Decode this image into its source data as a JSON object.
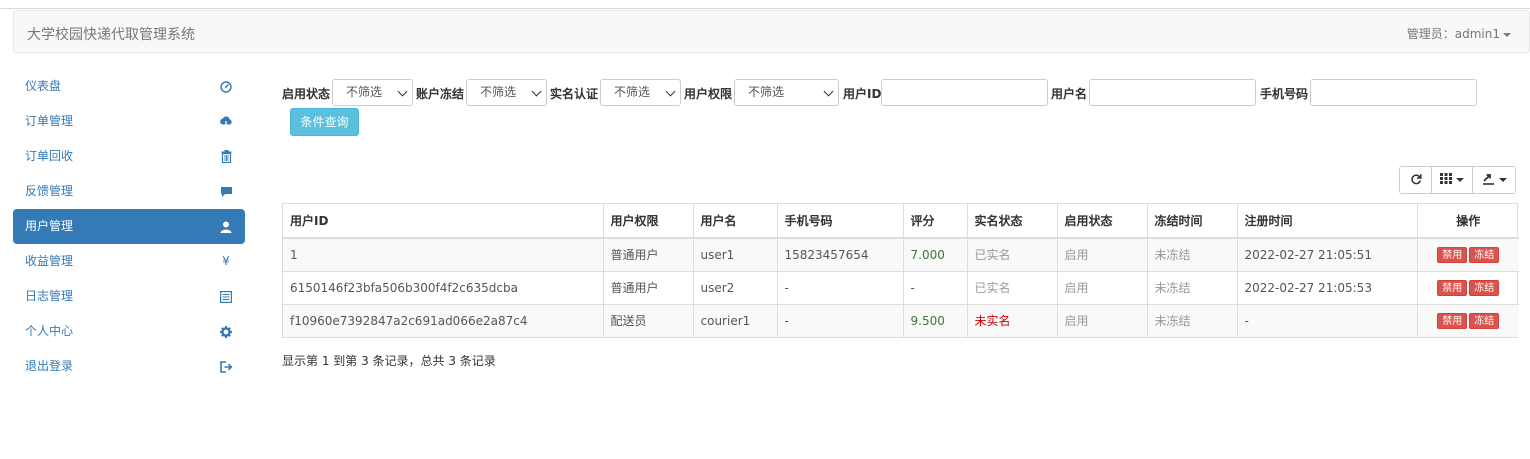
{
  "app": {
    "title": "大学校园快递代取管理系统",
    "admin_label": "管理员：admin1"
  },
  "sidebar": {
    "items": [
      {
        "label": "仪表盘",
        "icon": "dashboard-icon"
      },
      {
        "label": "订单管理",
        "icon": "cloud-download-icon"
      },
      {
        "label": "订单回收",
        "icon": "trash-icon"
      },
      {
        "label": "反馈管理",
        "icon": "comment-icon"
      },
      {
        "label": "用户管理",
        "icon": "user-icon",
        "active": true
      },
      {
        "label": "收益管理",
        "icon": "yen-icon"
      },
      {
        "label": "日志管理",
        "icon": "list-alt-icon"
      },
      {
        "label": "个人中心",
        "icon": "cog-icon"
      },
      {
        "label": "退出登录",
        "icon": "log-out-icon"
      }
    ],
    "active_color": "#337ab7"
  },
  "filters": {
    "enable_status": {
      "label": "启用状态",
      "value": "不筛选"
    },
    "freeze": {
      "label": "账户冻结",
      "value": "不筛选"
    },
    "realname": {
      "label": "实名认证",
      "value": "不筛选"
    },
    "permission": {
      "label": "用户权限",
      "value": "不筛选"
    },
    "user_id": {
      "label": "用户ID",
      "value": ""
    },
    "username": {
      "label": "用户名",
      "value": ""
    },
    "phone": {
      "label": "手机号码",
      "value": ""
    },
    "query_button": "条件查询"
  },
  "table": {
    "columns": [
      "用户ID",
      "用户权限",
      "用户名",
      "手机号码",
      "评分",
      "实名状态",
      "启用状态",
      "冻结时间",
      "注册时间",
      "操作"
    ],
    "rows": [
      {
        "id": "1",
        "role": "普通用户",
        "name": "user1",
        "phone": "15823457654",
        "score": "7.000",
        "realname": "已实名",
        "enabled": "启用",
        "frozen": "未冻结",
        "registered": "2022-02-27 21:05:51",
        "op1": "禁用",
        "op2": "冻结"
      },
      {
        "id": "6150146f23bfa506b300f4f2c635dcba",
        "role": "普通用户",
        "name": "user2",
        "phone": "-",
        "score": "-",
        "realname": "已实名",
        "enabled": "启用",
        "frozen": "未冻结",
        "registered": "2022-02-27 21:05:53",
        "op1": "禁用",
        "op2": "冻结"
      },
      {
        "id": "f10960e7392847a2c691ad066e2a87c4",
        "role": "配送员",
        "name": "courier1",
        "phone": "-",
        "score": "9.500",
        "realname": "未实名",
        "enabled": "启用",
        "frozen": "未冻结",
        "registered": "-",
        "op1": "禁用",
        "op2": "冻结"
      }
    ]
  },
  "pagination": {
    "info": "显示第 1 到第 3 条记录，总共 3 条记录"
  },
  "toolbar": {
    "icons": [
      "refresh-icon",
      "columns-icon",
      "export-icon"
    ]
  }
}
